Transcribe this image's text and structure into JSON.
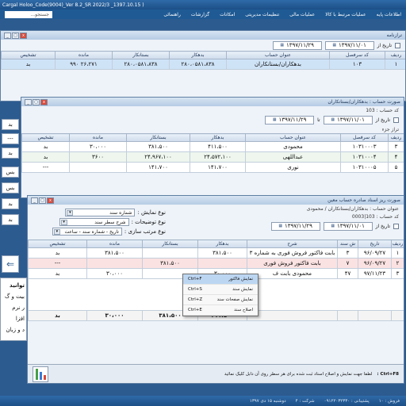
{
  "app": {
    "title": "Cargal Holoo_Code(9004)_Ver 8.2_SR 2022/3 _1397.10.15 )",
    "search_placeholder": "جستجو..."
  },
  "menu": [
    "اطلاعات پایه",
    "عملیات مرتبط با کالا",
    "عملیات مالی",
    "تنظیمات مدیریتی",
    "امکانات",
    "گزارشات",
    "راهنمائی"
  ],
  "win1": {
    "title": "ترازنامه",
    "tabs": [
      "ردیف",
      "کد سرفصل",
      "عنوان حساب",
      "بدهکار",
      "بستانکار",
      "مانده",
      "تشخیص"
    ],
    "row": [
      "۱",
      "۱۰۳",
      "بدهکاران/بستانکاران",
      "۲۸۰،۰۵۸۱،۸۳۸",
      "۲۸۰،۰۵۸۱،۸۳۸",
      "۲۶،۲۷۱ ۹۹۰",
      "بد"
    ],
    "date_from": "۱۳۹۷/۱۱/۰۱",
    "date_to": "۱۳۹۷/۱۱/۲۹",
    "date_label": "تاریخ از"
  },
  "win2": {
    "title": "صورت حساب : بدهکاران/بستانکاران",
    "code_label": "کد حساب :",
    "code": "103",
    "account": "بدهکاران/بستانکاران",
    "sub": "تراز جزء",
    "date_from": "۱۳۹۷/۱۱/۰۱",
    "date_to": "۱۳۹۷/۱۱/۲۹",
    "date_label": "تاریخ از",
    "to_label": "تا",
    "headers": [
      "ردیف",
      "کد سرفصل",
      "عنوان حساب",
      "بدهکار",
      "بستانکار",
      "مانده",
      "تشخیص"
    ],
    "rows": [
      [
        "۳",
        "۱۰۳۱۰۰۰۳",
        "محمودی",
        "۴۱۱،۵۰۰",
        "۳۸۱،۵۰۰",
        "۳۰،۰۰۰",
        "بد"
      ],
      [
        "۴",
        "۱۰۳۱۰۰۰۴",
        "عبداللهی",
        "۲۴،۵۷۲،۱۰۰",
        "۲۴،۹۶۷،۱۰۰",
        "۳۶۰۰",
        "بد"
      ],
      [
        "۵",
        "۱۰۳۱۰۰۰۵",
        "نوری",
        "۱۴۱،۷۰۰",
        "۱۴۱،۷۰۰",
        "",
        "---"
      ]
    ]
  },
  "win3": {
    "title": "صورت ریز اسناد صادره حساب معین",
    "account_label": "عنوان حساب :",
    "account": "بدهکاران/بستانکاران / محمودی",
    "code_label": "کد حساب :",
    "code": "103|0003",
    "display_label": "نوع نمایش :",
    "display_value": "شماره سند",
    "desc_label": "نوع توضیحات :",
    "desc_value": "شرح سطر سند",
    "sort_label": "نوع مرتب سازی :",
    "sort_value": "تاریخ - شماره سند - ساعت",
    "date_from": "۱۳۹۷/۱۱/۰۱",
    "date_to": "۱۳۹۷/۱۱/۲۹",
    "date_label": "تاریخ از",
    "headers": [
      "ردیف",
      "تاریخ",
      "ش سند",
      "شرح",
      "بدهکار",
      "بستانکار",
      "مانده",
      "تشخیص"
    ],
    "rows": [
      [
        "۱",
        "۹۶/۰۹/۲۷",
        "۳",
        "بابت فاکتور فروش فوری به شماره ۳",
        "۳۸۱،۵۰۰",
        "",
        "۳۸۱،۵۰۰",
        "بد"
      ],
      [
        "۲",
        "۹۶/۰۹/۲۷",
        "۷",
        "بابت فاکتور فروش فوری",
        "",
        "۳۸۱،۵۰۰",
        "",
        "---"
      ],
      [
        "۳",
        "۹۷/۱۱/۲۳",
        "۴۷",
        "محمودی بابت ف",
        "۳۰،۰۰۰",
        "",
        "۳۰،۰۰۰",
        "بد"
      ]
    ],
    "totals": [
      "",
      "",
      "",
      "",
      "۴۱۱،۵۰۰",
      "۳۸۱،۵۰۰",
      "۳۰،۰۰۰",
      "بد"
    ],
    "status_hint": "لطفا جهت نمایش و اصلاح اسناد ثبت شده برای هر سطر روی آن دابل کلیک نمائید",
    "status_key": "Ctrl+F8 :"
  },
  "context_menu": [
    {
      "key": "Ctrl+F",
      "label": "نمایش فاکتور"
    },
    {
      "key": "Ctrl+S",
      "label": "نمایش سند"
    },
    {
      "key": "Ctrl+Z",
      "label": "نمایش صفحات سند"
    },
    {
      "key": "Ctrl+E",
      "label": "اصلاح سند"
    }
  ],
  "side_buttons": [
    "بد",
    "---",
    "بد",
    "بس",
    "بس",
    "بد",
    "بد"
  ],
  "left_panel": {
    "text": [
      "توانید",
      "بیت و گ",
      "ر نرم افزا",
      "د و زبان"
    ]
  },
  "status": [
    "فروش : ۱۰",
    "پشتیبانی : ۰۹۱۲۲۰۳۲۳۳۰",
    "شرکت : ۴",
    "دوشنبه ۱۵ دی ۱۳۹۷"
  ],
  "colors": {
    "accent": "#2c5b8f"
  }
}
